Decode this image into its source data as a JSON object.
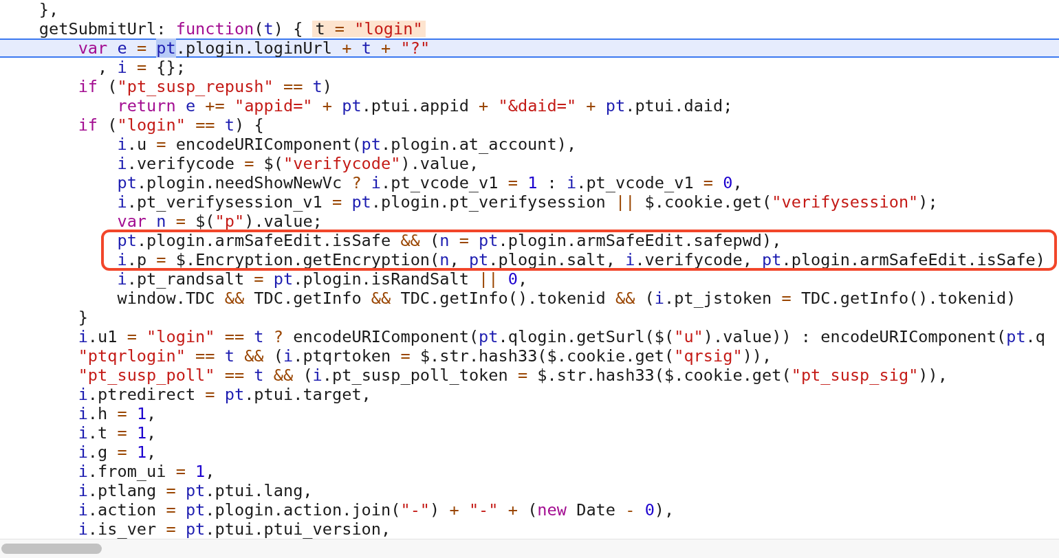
{
  "code_lines": [
    {
      "current": false,
      "boxed": false,
      "tokens": [
        {
          "kind": "plain",
          "text": "    },"
        }
      ]
    },
    {
      "current": false,
      "boxed": false,
      "tokens": [
        {
          "kind": "plain",
          "text": "    getSubmitUrl: "
        },
        {
          "kind": "keyword",
          "text": "function"
        },
        {
          "kind": "plain",
          "text": "("
        },
        {
          "kind": "name",
          "text": "t"
        },
        {
          "kind": "plain",
          "text": ") {"
        }
      ],
      "hint": [
        {
          "kind": "plain",
          "text": "t"
        },
        {
          "kind": "operator",
          "text": " = "
        },
        {
          "kind": "string",
          "text": "\"login\""
        }
      ]
    },
    {
      "current": true,
      "boxed": false,
      "tokens": [
        {
          "kind": "keyword",
          "text": "        var "
        },
        {
          "kind": "name",
          "text": "e"
        },
        {
          "kind": "operator",
          "text": " = "
        },
        {
          "kind": "selection",
          "text": "pt"
        },
        {
          "kind": "plain",
          "text": ".plogin.loginUrl"
        },
        {
          "kind": "operator",
          "text": " + "
        },
        {
          "kind": "name",
          "text": "t"
        },
        {
          "kind": "operator",
          "text": " + "
        },
        {
          "kind": "string",
          "text": "\"?\""
        }
      ]
    },
    {
      "current": false,
      "boxed": false,
      "tokens": [
        {
          "kind": "plain",
          "text": "          , "
        },
        {
          "kind": "name",
          "text": "i"
        },
        {
          "kind": "operator",
          "text": " = "
        },
        {
          "kind": "plain",
          "text": "{};"
        }
      ]
    },
    {
      "current": false,
      "boxed": false,
      "tokens": [
        {
          "kind": "keyword",
          "text": "        if "
        },
        {
          "kind": "plain",
          "text": "("
        },
        {
          "kind": "string",
          "text": "\"pt_susp_repush\""
        },
        {
          "kind": "operator",
          "text": " == "
        },
        {
          "kind": "name",
          "text": "t"
        },
        {
          "kind": "plain",
          "text": ")"
        }
      ]
    },
    {
      "current": false,
      "boxed": false,
      "tokens": [
        {
          "kind": "keyword",
          "text": "            return "
        },
        {
          "kind": "name",
          "text": "e"
        },
        {
          "kind": "operator",
          "text": " += "
        },
        {
          "kind": "string",
          "text": "\"appid=\""
        },
        {
          "kind": "operator",
          "text": " + "
        },
        {
          "kind": "name",
          "text": "pt"
        },
        {
          "kind": "plain",
          "text": ".ptui.appid"
        },
        {
          "kind": "operator",
          "text": " + "
        },
        {
          "kind": "string",
          "text": "\"&daid=\""
        },
        {
          "kind": "operator",
          "text": " + "
        },
        {
          "kind": "name",
          "text": "pt"
        },
        {
          "kind": "plain",
          "text": ".ptui.daid;"
        }
      ]
    },
    {
      "current": false,
      "boxed": false,
      "tokens": [
        {
          "kind": "keyword",
          "text": "        if "
        },
        {
          "kind": "plain",
          "text": "("
        },
        {
          "kind": "string",
          "text": "\"login\""
        },
        {
          "kind": "operator",
          "text": " == "
        },
        {
          "kind": "name",
          "text": "t"
        },
        {
          "kind": "plain",
          "text": ") {"
        }
      ]
    },
    {
      "current": false,
      "boxed": false,
      "tokens": [
        {
          "kind": "name",
          "text": "            i"
        },
        {
          "kind": "plain",
          "text": ".u"
        },
        {
          "kind": "operator",
          "text": " = "
        },
        {
          "kind": "plain",
          "text": "encodeURIComponent("
        },
        {
          "kind": "name",
          "text": "pt"
        },
        {
          "kind": "plain",
          "text": ".plogin.at_account),"
        }
      ]
    },
    {
      "current": false,
      "boxed": false,
      "tokens": [
        {
          "kind": "name",
          "text": "            i"
        },
        {
          "kind": "plain",
          "text": ".verifycode"
        },
        {
          "kind": "operator",
          "text": " = "
        },
        {
          "kind": "plain",
          "text": "$("
        },
        {
          "kind": "string",
          "text": "\"verifycode\""
        },
        {
          "kind": "plain",
          "text": ").value,"
        }
      ]
    },
    {
      "current": false,
      "boxed": false,
      "tokens": [
        {
          "kind": "name",
          "text": "            pt"
        },
        {
          "kind": "plain",
          "text": ".plogin.needShowNewVc"
        },
        {
          "kind": "operator",
          "text": " ? "
        },
        {
          "kind": "name",
          "text": "i"
        },
        {
          "kind": "plain",
          "text": ".pt_vcode_v1"
        },
        {
          "kind": "operator",
          "text": " = "
        },
        {
          "kind": "number",
          "text": "1"
        },
        {
          "kind": "plain",
          "text": " : "
        },
        {
          "kind": "name",
          "text": "i"
        },
        {
          "kind": "plain",
          "text": ".pt_vcode_v1"
        },
        {
          "kind": "operator",
          "text": " = "
        },
        {
          "kind": "number",
          "text": "0"
        },
        {
          "kind": "plain",
          "text": ","
        }
      ]
    },
    {
      "current": false,
      "boxed": false,
      "tokens": [
        {
          "kind": "name",
          "text": "            i"
        },
        {
          "kind": "plain",
          "text": ".pt_verifysession_v1"
        },
        {
          "kind": "operator",
          "text": " = "
        },
        {
          "kind": "name",
          "text": "pt"
        },
        {
          "kind": "plain",
          "text": ".plogin.pt_verifysession"
        },
        {
          "kind": "operator",
          "text": " || "
        },
        {
          "kind": "plain",
          "text": "$.cookie.get("
        },
        {
          "kind": "string",
          "text": "\"verifysession\""
        },
        {
          "kind": "plain",
          "text": ");"
        }
      ]
    },
    {
      "current": false,
      "boxed": false,
      "tokens": [
        {
          "kind": "keyword",
          "text": "            var "
        },
        {
          "kind": "name",
          "text": "n"
        },
        {
          "kind": "operator",
          "text": " = "
        },
        {
          "kind": "plain",
          "text": "$("
        },
        {
          "kind": "string",
          "text": "\"p\""
        },
        {
          "kind": "plain",
          "text": ").value;"
        }
      ]
    },
    {
      "current": false,
      "boxed": true,
      "tokens": [
        {
          "kind": "name",
          "text": "            pt"
        },
        {
          "kind": "plain",
          "text": ".plogin.armSafeEdit.isSafe"
        },
        {
          "kind": "operator",
          "text": " && "
        },
        {
          "kind": "plain",
          "text": "("
        },
        {
          "kind": "name",
          "text": "n"
        },
        {
          "kind": "operator",
          "text": " = "
        },
        {
          "kind": "name",
          "text": "pt"
        },
        {
          "kind": "plain",
          "text": ".plogin.armSafeEdit.safepwd),"
        }
      ]
    },
    {
      "current": false,
      "boxed": true,
      "tokens": [
        {
          "kind": "name",
          "text": "            i"
        },
        {
          "kind": "plain",
          "text": ".p"
        },
        {
          "kind": "operator",
          "text": " = "
        },
        {
          "kind": "plain",
          "text": "$.Encryption.getEncryption("
        },
        {
          "kind": "name",
          "text": "n"
        },
        {
          "kind": "plain",
          "text": ", "
        },
        {
          "kind": "name",
          "text": "pt"
        },
        {
          "kind": "plain",
          "text": ".plogin.salt, "
        },
        {
          "kind": "name",
          "text": "i"
        },
        {
          "kind": "plain",
          "text": ".verifycode, "
        },
        {
          "kind": "name",
          "text": "pt"
        },
        {
          "kind": "plain",
          "text": ".plogin.armSafeEdit.isSafe)"
        }
      ]
    },
    {
      "current": false,
      "boxed": false,
      "tokens": [
        {
          "kind": "name",
          "text": "            i"
        },
        {
          "kind": "plain",
          "text": ".pt_randsalt"
        },
        {
          "kind": "operator",
          "text": " = "
        },
        {
          "kind": "name",
          "text": "pt"
        },
        {
          "kind": "plain",
          "text": ".plogin.isRandSalt"
        },
        {
          "kind": "operator",
          "text": " || "
        },
        {
          "kind": "number",
          "text": "0"
        },
        {
          "kind": "plain",
          "text": ","
        }
      ]
    },
    {
      "current": false,
      "boxed": false,
      "tokens": [
        {
          "kind": "plain",
          "text": "            window.TDC"
        },
        {
          "kind": "operator",
          "text": " && "
        },
        {
          "kind": "plain",
          "text": "TDC.getInfo"
        },
        {
          "kind": "operator",
          "text": " && "
        },
        {
          "kind": "plain",
          "text": "TDC.getInfo().tokenid"
        },
        {
          "kind": "operator",
          "text": " && "
        },
        {
          "kind": "plain",
          "text": "("
        },
        {
          "kind": "name",
          "text": "i"
        },
        {
          "kind": "plain",
          "text": ".pt_jstoken"
        },
        {
          "kind": "operator",
          "text": " = "
        },
        {
          "kind": "plain",
          "text": "TDC.getInfo().tokenid)"
        }
      ]
    },
    {
      "current": false,
      "boxed": false,
      "tokens": [
        {
          "kind": "plain",
          "text": "        }"
        }
      ]
    },
    {
      "current": false,
      "boxed": false,
      "tokens": [
        {
          "kind": "name",
          "text": "        i"
        },
        {
          "kind": "plain",
          "text": ".u1"
        },
        {
          "kind": "operator",
          "text": " = "
        },
        {
          "kind": "string",
          "text": "\"login\""
        },
        {
          "kind": "operator",
          "text": " == "
        },
        {
          "kind": "name",
          "text": "t"
        },
        {
          "kind": "operator",
          "text": " ? "
        },
        {
          "kind": "plain",
          "text": "encodeURIComponent("
        },
        {
          "kind": "name",
          "text": "pt"
        },
        {
          "kind": "plain",
          "text": ".qlogin.getSurl($("
        },
        {
          "kind": "string",
          "text": "\"u\""
        },
        {
          "kind": "plain",
          "text": ").value)) : encodeURIComponent("
        },
        {
          "kind": "name",
          "text": "pt"
        },
        {
          "kind": "plain",
          "text": ".q"
        }
      ]
    },
    {
      "current": false,
      "boxed": false,
      "tokens": [
        {
          "kind": "string",
          "text": "        \"ptqrlogin\""
        },
        {
          "kind": "operator",
          "text": " == "
        },
        {
          "kind": "name",
          "text": "t"
        },
        {
          "kind": "operator",
          "text": " && "
        },
        {
          "kind": "plain",
          "text": "("
        },
        {
          "kind": "name",
          "text": "i"
        },
        {
          "kind": "plain",
          "text": ".ptqrtoken"
        },
        {
          "kind": "operator",
          "text": " = "
        },
        {
          "kind": "plain",
          "text": "$.str.hash33($.cookie.get("
        },
        {
          "kind": "string",
          "text": "\"qrsig\""
        },
        {
          "kind": "plain",
          "text": ")),"
        }
      ]
    },
    {
      "current": false,
      "boxed": false,
      "tokens": [
        {
          "kind": "string",
          "text": "        \"pt_susp_poll\""
        },
        {
          "kind": "operator",
          "text": " == "
        },
        {
          "kind": "name",
          "text": "t"
        },
        {
          "kind": "operator",
          "text": " && "
        },
        {
          "kind": "plain",
          "text": "("
        },
        {
          "kind": "name",
          "text": "i"
        },
        {
          "kind": "plain",
          "text": ".pt_susp_poll_token"
        },
        {
          "kind": "operator",
          "text": " = "
        },
        {
          "kind": "plain",
          "text": "$.str.hash33($.cookie.get("
        },
        {
          "kind": "string",
          "text": "\"pt_susp_sig\""
        },
        {
          "kind": "plain",
          "text": ")),"
        }
      ]
    },
    {
      "current": false,
      "boxed": false,
      "tokens": [
        {
          "kind": "name",
          "text": "        i"
        },
        {
          "kind": "plain",
          "text": ".ptredirect"
        },
        {
          "kind": "operator",
          "text": " = "
        },
        {
          "kind": "name",
          "text": "pt"
        },
        {
          "kind": "plain",
          "text": ".ptui.target,"
        }
      ]
    },
    {
      "current": false,
      "boxed": false,
      "tokens": [
        {
          "kind": "name",
          "text": "        i"
        },
        {
          "kind": "plain",
          "text": ".h"
        },
        {
          "kind": "operator",
          "text": " = "
        },
        {
          "kind": "number",
          "text": "1"
        },
        {
          "kind": "plain",
          "text": ","
        }
      ]
    },
    {
      "current": false,
      "boxed": false,
      "tokens": [
        {
          "kind": "name",
          "text": "        i"
        },
        {
          "kind": "plain",
          "text": ".t"
        },
        {
          "kind": "operator",
          "text": " = "
        },
        {
          "kind": "number",
          "text": "1"
        },
        {
          "kind": "plain",
          "text": ","
        }
      ]
    },
    {
      "current": false,
      "boxed": false,
      "tokens": [
        {
          "kind": "name",
          "text": "        i"
        },
        {
          "kind": "plain",
          "text": ".g"
        },
        {
          "kind": "operator",
          "text": " = "
        },
        {
          "kind": "number",
          "text": "1"
        },
        {
          "kind": "plain",
          "text": ","
        }
      ]
    },
    {
      "current": false,
      "boxed": false,
      "tokens": [
        {
          "kind": "name",
          "text": "        i"
        },
        {
          "kind": "plain",
          "text": ".from_ui"
        },
        {
          "kind": "operator",
          "text": " = "
        },
        {
          "kind": "number",
          "text": "1"
        },
        {
          "kind": "plain",
          "text": ","
        }
      ]
    },
    {
      "current": false,
      "boxed": false,
      "tokens": [
        {
          "kind": "name",
          "text": "        i"
        },
        {
          "kind": "plain",
          "text": ".ptlang"
        },
        {
          "kind": "operator",
          "text": " = "
        },
        {
          "kind": "name",
          "text": "pt"
        },
        {
          "kind": "plain",
          "text": ".ptui.lang,"
        }
      ]
    },
    {
      "current": false,
      "boxed": false,
      "tokens": [
        {
          "kind": "name",
          "text": "        i"
        },
        {
          "kind": "plain",
          "text": ".action"
        },
        {
          "kind": "operator",
          "text": " = "
        },
        {
          "kind": "name",
          "text": "pt"
        },
        {
          "kind": "plain",
          "text": ".plogin.action.join("
        },
        {
          "kind": "string",
          "text": "\"-\""
        },
        {
          "kind": "plain",
          "text": ")"
        },
        {
          "kind": "operator",
          "text": " + "
        },
        {
          "kind": "string",
          "text": "\"-\""
        },
        {
          "kind": "operator",
          "text": " + "
        },
        {
          "kind": "plain",
          "text": "("
        },
        {
          "kind": "keyword",
          "text": "new"
        },
        {
          "kind": "plain",
          "text": " Date"
        },
        {
          "kind": "operator",
          "text": " - "
        },
        {
          "kind": "number",
          "text": "0"
        },
        {
          "kind": "plain",
          "text": "),"
        }
      ]
    },
    {
      "current": false,
      "boxed": false,
      "tokens": [
        {
          "kind": "name",
          "text": "        i"
        },
        {
          "kind": "plain",
          "text": ".is_ver"
        },
        {
          "kind": "operator",
          "text": " = "
        },
        {
          "kind": "name",
          "text": "pt"
        },
        {
          "kind": "plain",
          "text": ".ptui.ptui_version,"
        }
      ]
    }
  ]
}
